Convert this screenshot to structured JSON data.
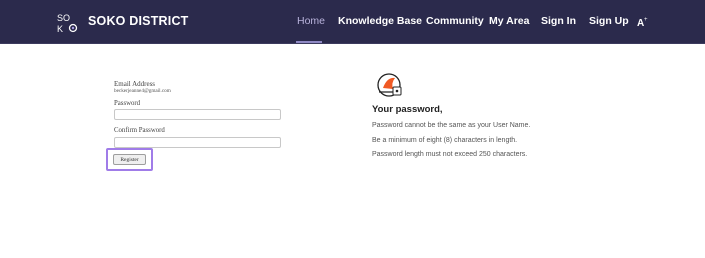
{
  "header": {
    "brand": "SOKO DISTRICT",
    "logo_icon": "soko-logo-icon",
    "nav": [
      {
        "label": "Home",
        "active": true
      },
      {
        "label": "Knowledge Base",
        "active": false
      },
      {
        "label": "Community",
        "active": false
      },
      {
        "label": "My Area",
        "active": false
      },
      {
        "label": "Sign In",
        "active": false
      },
      {
        "label": "Sign Up",
        "active": false
      }
    ],
    "accessibility_icon": "text-size-icon",
    "bar_color": "#2b2a4c"
  },
  "form": {
    "email_label": "Email Address",
    "email_value": "beckerjeanne4@gmail.com",
    "password_label": "Password",
    "password_value": "",
    "confirm_label": "Confirm Password",
    "confirm_value": "",
    "register_label": "Register",
    "highlight_color": "#a07ce8"
  },
  "info": {
    "icon": "password-shield-icon",
    "title": "Your password,",
    "rules": [
      "Password cannot be the same as your User Name.",
      "Be a minimum of eight (8) characters in length.",
      "Password length must not exceed 250 characters."
    ]
  }
}
